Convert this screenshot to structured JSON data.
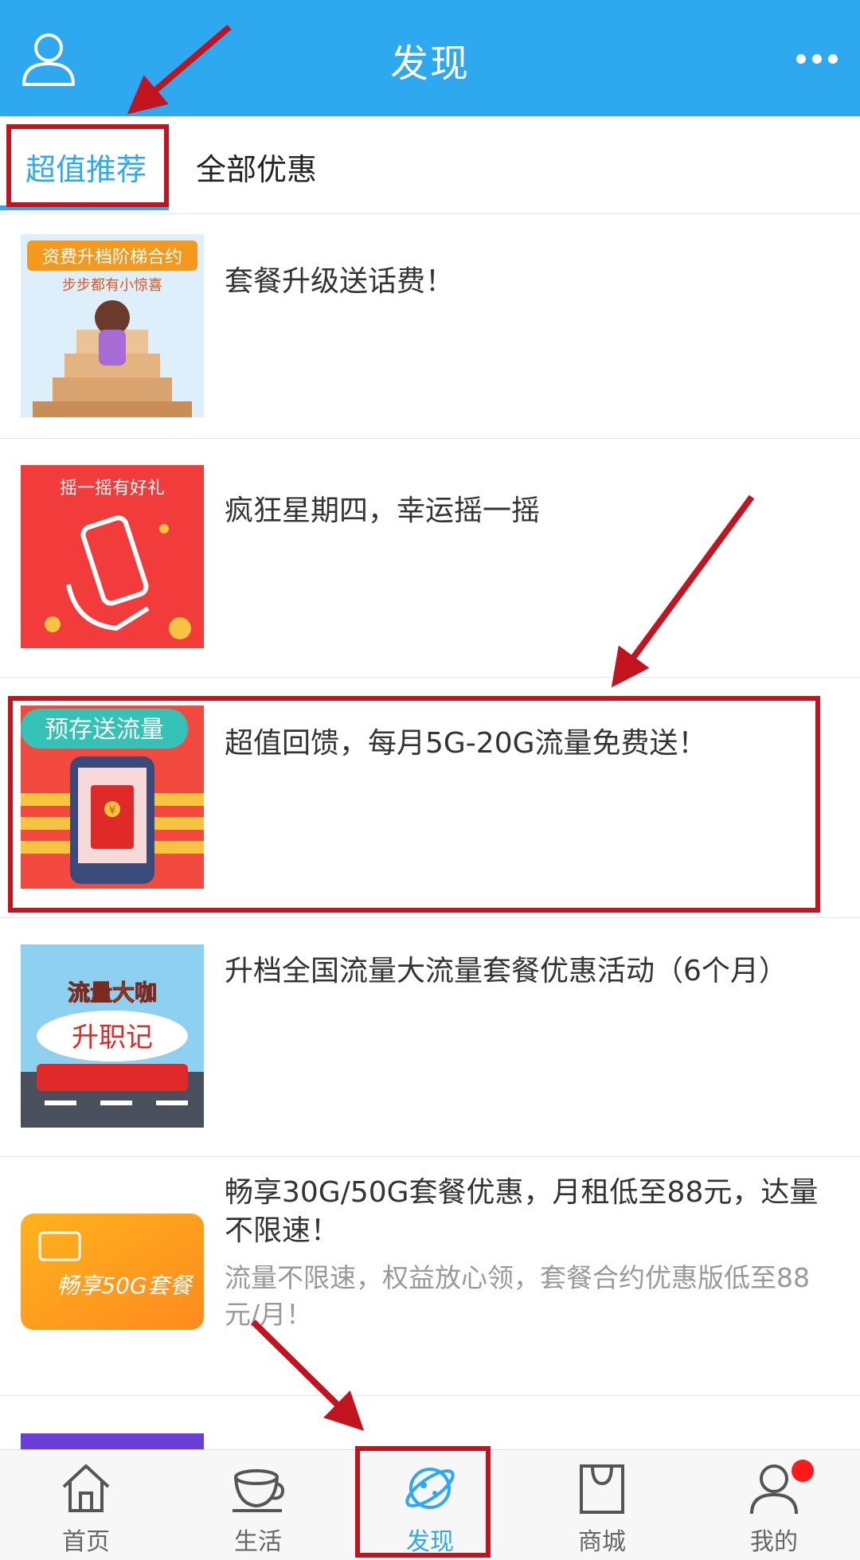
{
  "header": {
    "title": "发现",
    "left_icon": "user-icon",
    "right_icon": "more-icon",
    "bg_color": "#2ea8ee"
  },
  "tabs": [
    {
      "label": "超值推荐",
      "active": true
    },
    {
      "label": "全部优惠",
      "active": false
    }
  ],
  "promo_items": [
    {
      "title": "套餐升级送话费！",
      "subtitle": "",
      "thumb_text_1": "资费升档阶梯合约",
      "thumb_text_2": "步步都有小惊喜"
    },
    {
      "title": "疯狂星期四，幸运摇一摇",
      "subtitle": "",
      "thumb_text_1": "摇一摇有好礼",
      "thumb_text_2": ""
    },
    {
      "title": "超值回馈，每月5G-20G流量免费送！",
      "subtitle": "",
      "thumb_text_1": "预存送流量",
      "thumb_text_2": "¥"
    },
    {
      "title": "升档全国流量大流量套餐优惠活动（6个月）",
      "subtitle": "",
      "thumb_text_1": "流量大咖",
      "thumb_text_2": "升职记"
    },
    {
      "title": "畅享30G/50G套餐优惠，月租低至88元，达量不限速！",
      "subtitle": "流量不限速，权益放心领，套餐合约优惠版低至88元/月！",
      "thumb_text_1": "畅享50G套餐",
      "thumb_text_2": ""
    }
  ],
  "bottom_nav": [
    {
      "label": "首页",
      "icon": "home-icon",
      "active": false
    },
    {
      "label": "生活",
      "icon": "coffee-cup-icon",
      "active": false
    },
    {
      "label": "发现",
      "icon": "planet-icon",
      "active": true
    },
    {
      "label": "商城",
      "icon": "shopping-bag-icon",
      "active": false
    },
    {
      "label": "我的",
      "icon": "profile-icon",
      "active": false,
      "badge": true
    }
  ],
  "colors": {
    "accent": "#2ea8ee",
    "annotation": "#c1141e",
    "badge": "#ff1a1a"
  }
}
